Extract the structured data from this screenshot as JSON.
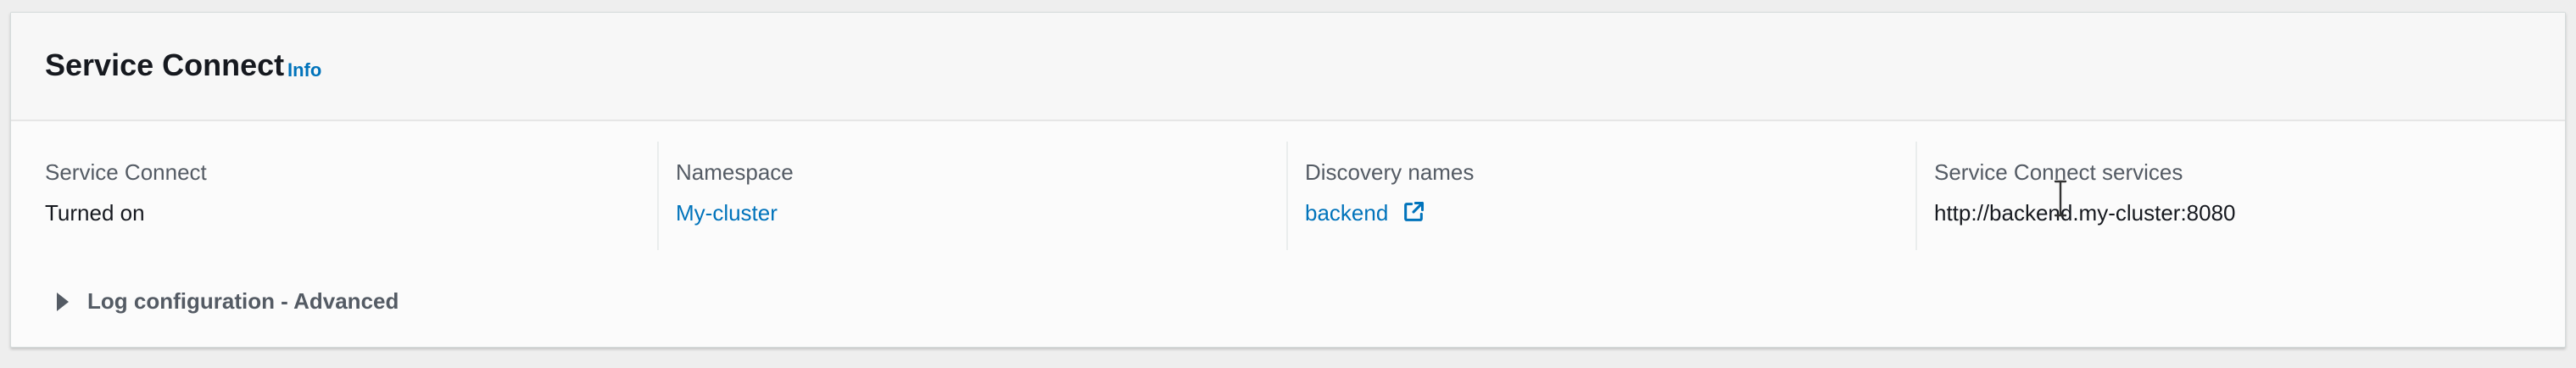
{
  "header": {
    "title": "Service Connect",
    "info_label": "Info"
  },
  "columns": [
    {
      "label": "Service Connect",
      "value": "Turned on"
    },
    {
      "label": "Namespace",
      "value": "My-cluster"
    },
    {
      "label": "Discovery names",
      "value": "backend",
      "icon": "external-link-icon"
    },
    {
      "label": "Service Connect services",
      "value": "http://backend.my-cluster:8080"
    }
  ],
  "log_configuration": {
    "label": "Log configuration - Advanced",
    "icon": "caret-right-icon"
  },
  "colors": {
    "link": "#0073bb",
    "text": "#16191f",
    "label": "#545b64"
  }
}
